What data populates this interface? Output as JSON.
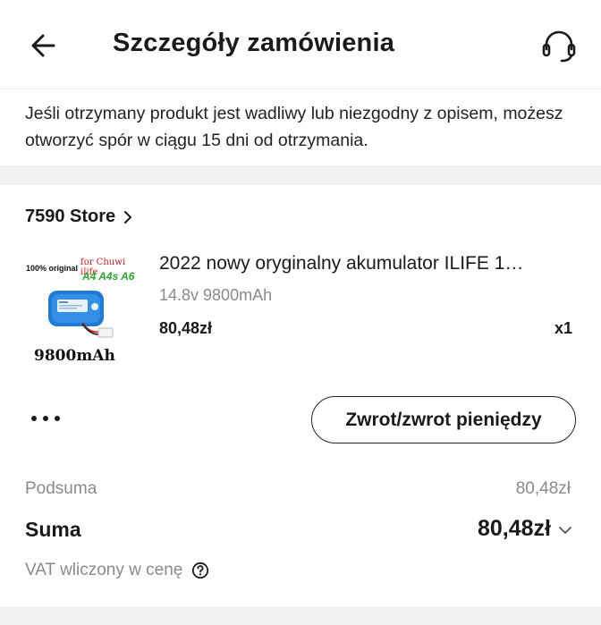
{
  "header": {
    "title": "Szczegóły zamówienia"
  },
  "notice": {
    "text": "Jeśli otrzymany produkt jest wadliwy lub niezgodny z opisem, możesz otworzyć spór w ciągu 15 dni od otrzymania."
  },
  "order": {
    "store_name": "7590 Store",
    "product": {
      "image_text": {
        "original": "100% original",
        "brand": "for Chuwi ilife",
        "models": "A4 A4s A6",
        "capacity": "9800mAh"
      },
      "name": "2022 nowy oryginalny akumulator ILIFE 1…",
      "variant": "14.8v 9800mAh",
      "price": "80,48zł",
      "quantity": "x1"
    },
    "actions": {
      "refund_label": "Zwrot/zwrot pieniędzy"
    },
    "summary": {
      "subtotal_label": "Podsuma",
      "subtotal_value": "80,48zł",
      "total_label": "Suma",
      "total_value": "80,48zł",
      "vat_text": "VAT wliczony w cenę"
    }
  },
  "icons": {
    "back": "arrow-left-icon",
    "support": "headset-icon",
    "store_chevron": "chevron-right-icon",
    "more": "more-dots-icon",
    "total_expand": "chevron-down-icon",
    "help": "question-circle-icon"
  }
}
